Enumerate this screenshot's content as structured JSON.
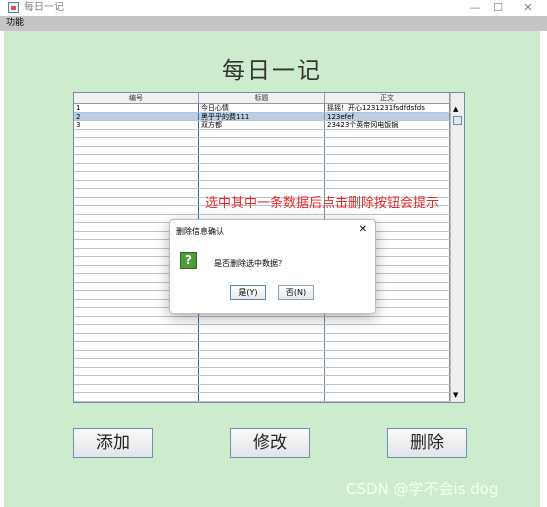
{
  "window": {
    "title": "每日一记",
    "minimize": "—",
    "maximize": "☐",
    "close": "✕"
  },
  "menu": {
    "items": [
      "功能"
    ]
  },
  "app": {
    "heading": "每日一记"
  },
  "table": {
    "columns": [
      "编号",
      "标题",
      "正文"
    ],
    "rows": [
      [
        "1",
        "今日心情",
        "摇摇！开心1231231fsdfdsfds"
      ],
      [
        "2",
        "黑乎乎的费111",
        "123efef"
      ],
      [
        "3",
        "双方都",
        "23423个英帝冈电饭锅"
      ]
    ],
    "selected_row": 2,
    "empty_rows": 32
  },
  "buttons": {
    "add": "添加",
    "edit": "修改",
    "delete": "删除"
  },
  "annotation": "选中其中一条数据后点击删除按钮会提示",
  "dialog": {
    "title": "删除信息确认",
    "close": "✕",
    "icon": "question-icon",
    "icon_glyph": "?",
    "message": "是否删除选中数据？",
    "yes": "是(Y)",
    "no": "否(N)"
  },
  "watermark": "CSDN @学不会is dog",
  "colors": {
    "background": "#cdeccd",
    "selection": "#b8cfe5",
    "annotation": "#e52a2a",
    "menubar": "#c5c5c5"
  }
}
